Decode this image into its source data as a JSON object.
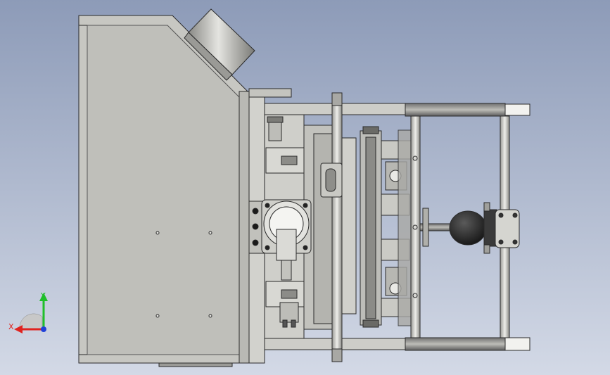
{
  "view": {
    "background_top": "#8d9bb8",
    "background_bottom": "#d3d9e6",
    "body_color": "#c6c6c1",
    "edge_color": "#2a2a2a"
  },
  "triad": {
    "x_label": "X",
    "y_label": "Y",
    "x_color": "#e0231f",
    "y_color": "#1fbf2a",
    "z_color": "#2040d8"
  }
}
